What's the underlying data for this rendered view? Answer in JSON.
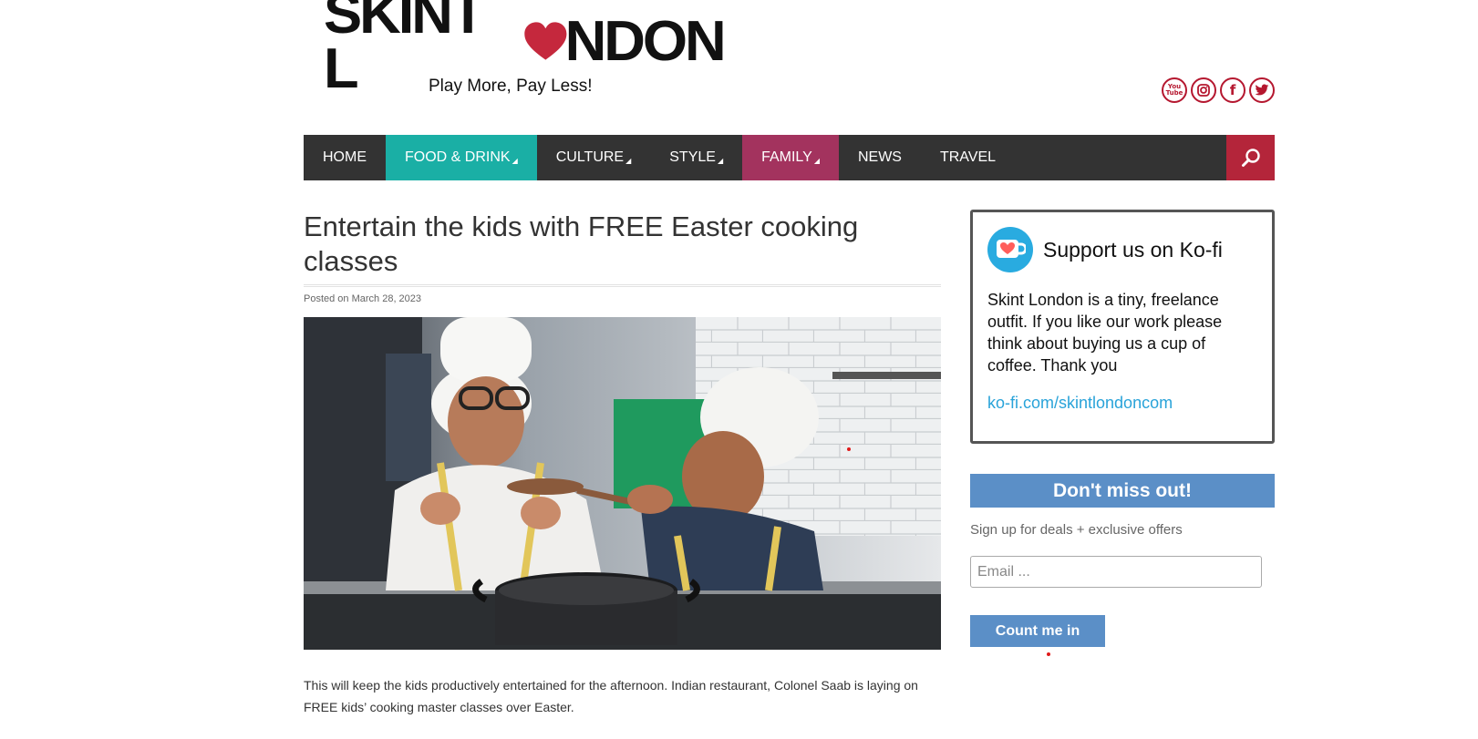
{
  "header": {
    "logo_text_left": "SKINT L",
    "logo_text_right": "NDON",
    "tagline": "Play More, Pay Less!",
    "socials": [
      {
        "icon": "youtube-icon",
        "label": "You Tube"
      },
      {
        "icon": "instagram-icon",
        "label": "◎"
      },
      {
        "icon": "facebook-icon",
        "label": "f"
      },
      {
        "icon": "twitter-icon",
        "label": "🐦"
      }
    ]
  },
  "nav": {
    "items": [
      {
        "label": "HOME",
        "bg": "#333333"
      },
      {
        "label": "FOOD & DRINK",
        "bg": "#1aafa5",
        "caret": "◢"
      },
      {
        "label": "CULTURE",
        "bg": "#333333",
        "caret": "◢"
      },
      {
        "label": "STYLE",
        "bg": "#333333",
        "caret": "◢"
      },
      {
        "label": "FAMILY",
        "bg": "#a3335e",
        "caret": "◢"
      },
      {
        "label": "NEWS",
        "bg": "#333333"
      },
      {
        "label": "TRAVEL",
        "bg": "#333333"
      }
    ],
    "search_icon": "search-icon"
  },
  "article": {
    "title": "Entertain the kids with FREE Easter cooking classes",
    "meta": "Posted on March 28, 2023",
    "body": "This will keep the kids productively entertained for the afternoon. Indian restaurant, Colonel Saab is laying on FREE kids’ cooking master classes over Easter."
  },
  "sidebar": {
    "kofi_title": "Support us on Ko-fi",
    "kofi_text": "Skint London is a tiny, freelance outfit. If you like our work please think about buying us a cup of coffee. Thank you",
    "kofi_link": "ko-fi.com/skintlondoncom",
    "dmo_title": "Don't miss out!",
    "signup_text": "Sign up for deals + exclusive offers",
    "email_placeholder": "Email ...",
    "button_label": "Count me in"
  },
  "colors": {
    "brand_red": "#b4253a",
    "teal": "#1aafa5",
    "plum": "#a3335e",
    "blue": "#5b8fc7",
    "kofi": "#29abe0"
  }
}
